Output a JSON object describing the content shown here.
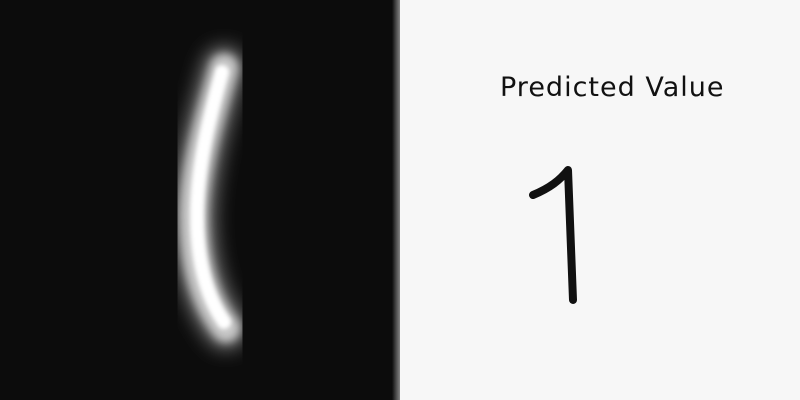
{
  "input_image": {
    "description_icon": "handwritten-digit-image",
    "background_color": "#0c0c0c",
    "stroke_color": "#ffffff"
  },
  "result": {
    "title": "Predicted Value",
    "value": "1",
    "text_color": "#111111",
    "panel_color": "#f7f7f7"
  }
}
